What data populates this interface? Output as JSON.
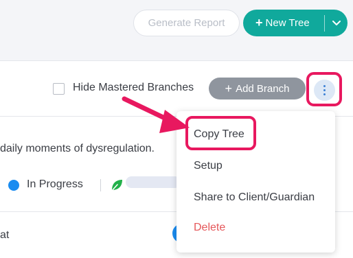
{
  "toolbar": {
    "generate_report_label": "Generate Report",
    "new_tree_plus": "+",
    "new_tree_label": "New Tree"
  },
  "tree_header": {
    "hide_mastered_label": "Hide Mastered Branches",
    "hide_mastered_checked": false,
    "add_branch_plus": "+",
    "add_branch_label": "Add Branch"
  },
  "branch": {
    "description": "daily moments of dysregulation.",
    "status_label": "In Progress",
    "status_color": "#1a8cf0"
  },
  "next_row": {
    "text": "at"
  },
  "menu": {
    "items": [
      {
        "label": "Copy Tree"
      },
      {
        "label": "Setup"
      },
      {
        "label": "Share to Client/Guardian"
      },
      {
        "label": "Delete"
      }
    ]
  },
  "colors": {
    "accent": "#10a99c",
    "highlight": "#e8185f",
    "danger": "#e5575a",
    "neutral_button": "#8f959e"
  },
  "icons": {
    "kebab": "vertical-dots-icon",
    "caret": "chevron-down-icon",
    "leaf": "leaf-icon",
    "pointer": "arrow-pointer"
  }
}
